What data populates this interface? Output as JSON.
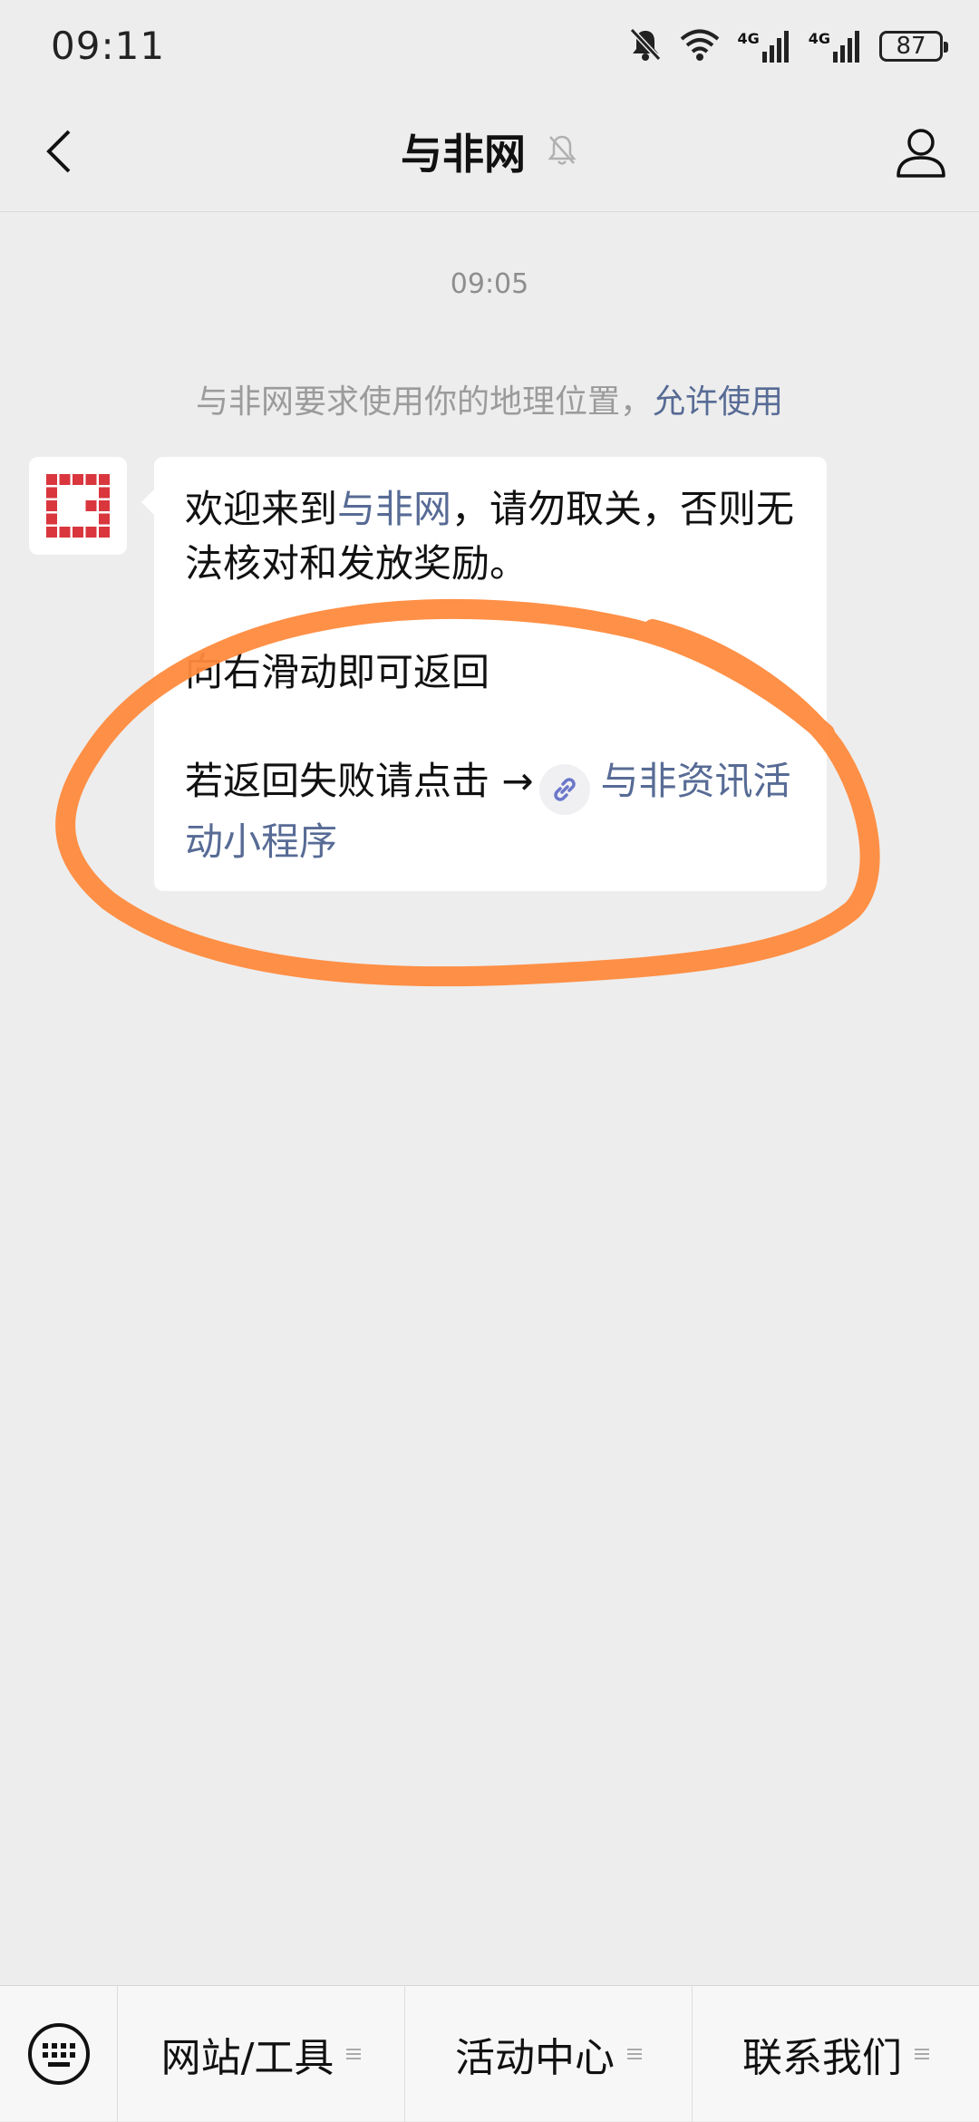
{
  "status_bar": {
    "time": "09:11",
    "battery": "87",
    "network_1": "4G",
    "network_2": "4G"
  },
  "nav": {
    "title": "与非网"
  },
  "chat": {
    "timestamp": "09:05",
    "system_notice": {
      "text": "与非网要求使用你的地理位置，",
      "link": "允许使用"
    },
    "message": {
      "line1_pre": "欢迎来到",
      "line1_link": "与非网",
      "line1_post": "，请勿取关，否则无法核对和发放奖励。",
      "line2": "向右滑动即可返回",
      "line3_pre": "若返回失败请点击 →",
      "line3_link": "与非资讯活动小程序"
    }
  },
  "bottom_menu": {
    "items": [
      {
        "label": "网站/工具"
      },
      {
        "label": "活动中心"
      },
      {
        "label": "联系我们"
      }
    ]
  },
  "colors": {
    "link": "#576b95",
    "avatar_red": "#d9363e",
    "annotation": "#ff8a3d"
  }
}
